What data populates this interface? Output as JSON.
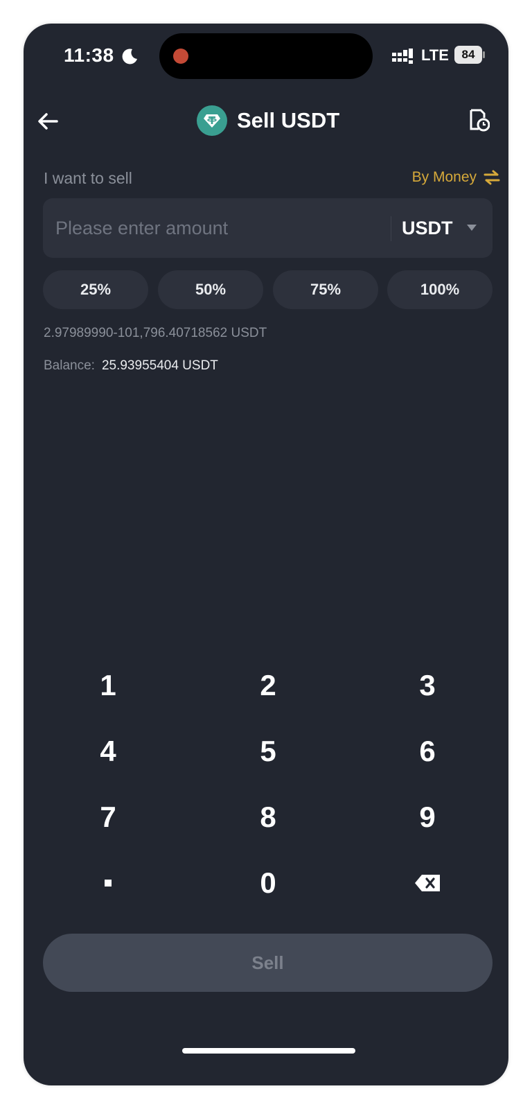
{
  "status_bar": {
    "time": "11:38",
    "network": "LTE",
    "battery": "84"
  },
  "header": {
    "title": "Sell USDT",
    "icons": [
      "back-arrow-icon",
      "tether-coin-icon",
      "order-history-icon"
    ]
  },
  "sell_form": {
    "want_label": "I want to sell",
    "by_money_label": "By Money",
    "amount_placeholder": "Please enter amount",
    "amount_value": "",
    "currency": "USDT",
    "percent_buttons": [
      "25%",
      "50%",
      "75%",
      "100%"
    ],
    "range_text": "2.97989990-101,796.40718562 USDT",
    "balance_label": "Balance:",
    "balance_value": "25.93955404 USDT"
  },
  "keypad": {
    "keys": [
      "1",
      "2",
      "3",
      "4",
      "5",
      "6",
      "7",
      "8",
      "9",
      ".",
      "0",
      "backspace"
    ]
  },
  "actions": {
    "sell_label": "Sell"
  },
  "colors": {
    "background": "#222630",
    "surface": "#2d313c",
    "accent_gold": "#d6a93a",
    "tether_green": "#3a9f91",
    "disabled_button": "#434956"
  }
}
